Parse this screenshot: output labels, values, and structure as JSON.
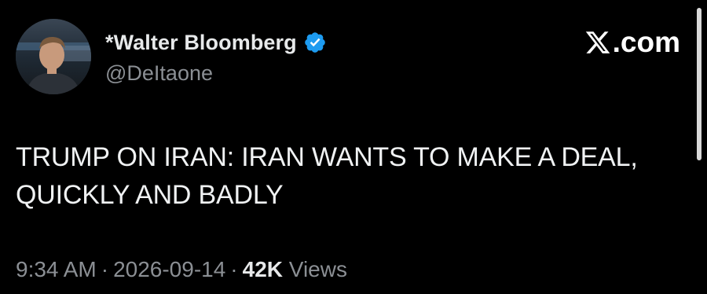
{
  "author": {
    "display_name": "*Walter Bloomberg",
    "handle": "@DeItaone",
    "avatar_icon": "person-photo",
    "verified_icon": "verified-badge-icon",
    "verified_color": "#1d9bf0"
  },
  "brand": {
    "logo_icon": "x-logo-icon",
    "text": ".com"
  },
  "tweet": {
    "line1": "TRUMP ON IRAN: IRAN WANTS TO MAKE A DEAL,",
    "line2": "QUICKLY AND BADLY"
  },
  "meta": {
    "time": "9:34 AM",
    "separator": "·",
    "date": "2026-09-14",
    "views_count": "42K",
    "views_label": "Views"
  }
}
